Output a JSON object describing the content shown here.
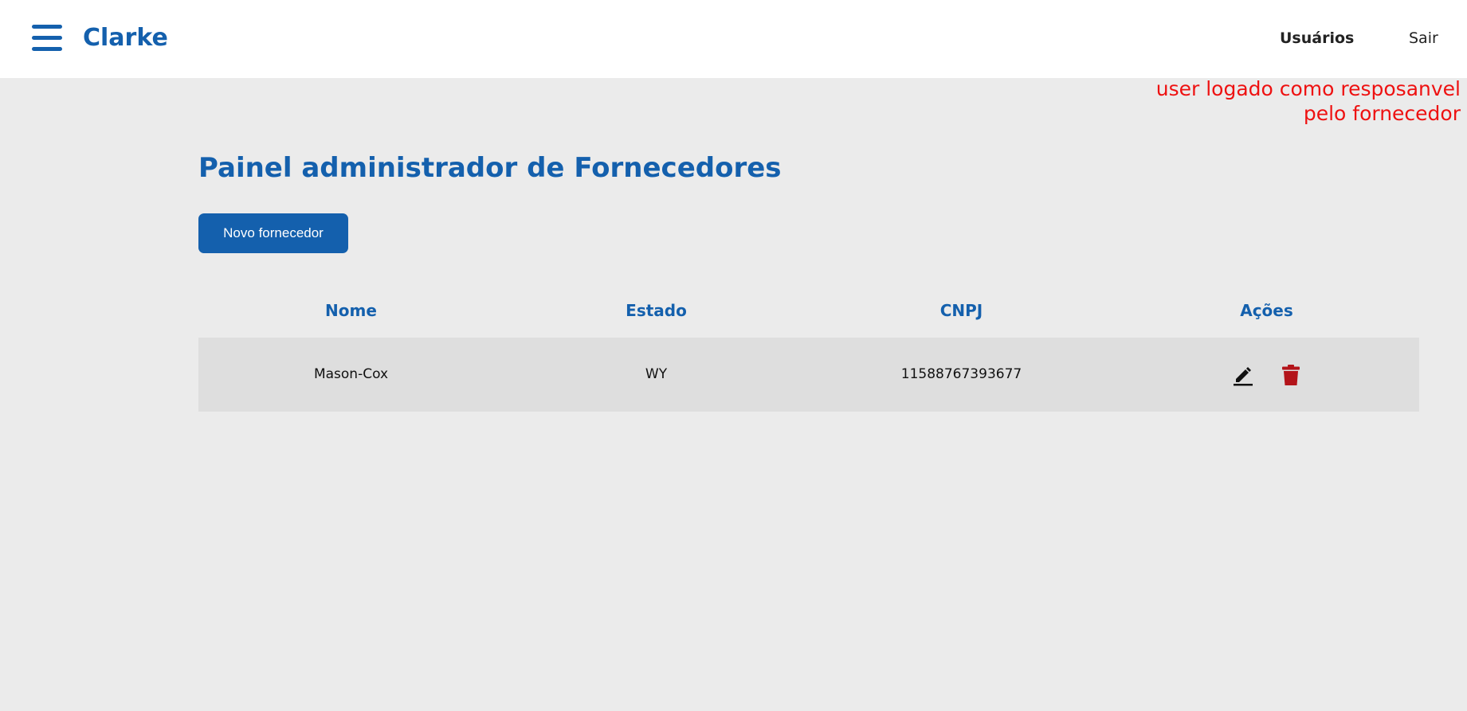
{
  "header": {
    "menu_icon": "hamburger-menu-icon",
    "brand": "Clarke",
    "nav": {
      "users_label": "Usuários",
      "logout_label": "Sair"
    }
  },
  "annotation": {
    "line1": "user logado como resposanvel",
    "line2": "pelo fornecedor",
    "color": "#ee1111"
  },
  "main": {
    "title": "Painel administrador de Fornecedores",
    "new_button_label": "Novo fornecedor",
    "table": {
      "columns": [
        "Nome",
        "Estado",
        "CNPJ",
        "Ações"
      ],
      "rows": [
        {
          "nome": "Mason-Cox",
          "estado": "WY",
          "cnpj": "11588767393677",
          "actions": [
            "edit-pencil-icon",
            "delete-trash-icon"
          ]
        }
      ]
    }
  },
  "colors": {
    "brand": "#1460ad",
    "background": "#ebebeb",
    "row": "#dedede",
    "delete": "#b3141a"
  }
}
